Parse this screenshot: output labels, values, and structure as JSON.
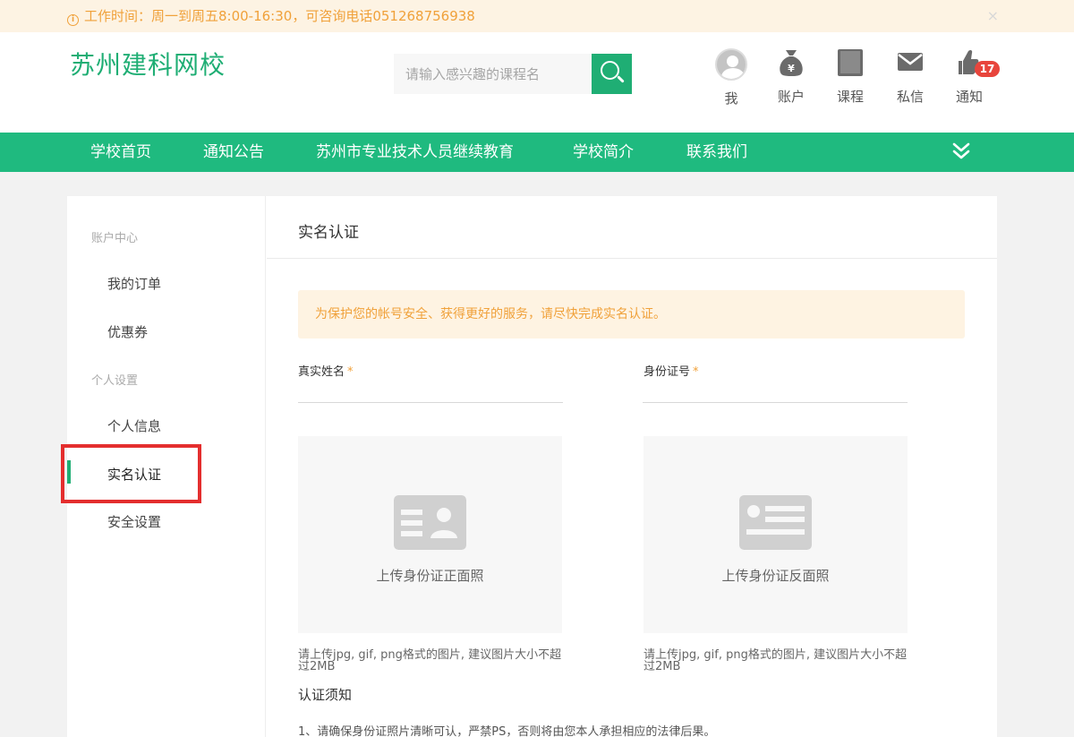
{
  "notice": {
    "text": "工作时间：周一到周五8:00-16:30，可咨询电话051268756938",
    "icon": "info-icon",
    "close": "×"
  },
  "header": {
    "logo": "苏州建科网校",
    "search": {
      "placeholder": "请输入感兴趣的课程名",
      "icon": "search-icon"
    },
    "user_nav": [
      {
        "label": "我",
        "icon": "avatar"
      },
      {
        "label": "账户",
        "icon": "money-bag-icon"
      },
      {
        "label": "课程",
        "icon": "book-icon"
      },
      {
        "label": "私信",
        "icon": "envelope-icon"
      },
      {
        "label": "通知",
        "icon": "bell-icon",
        "badge": "17"
      }
    ]
  },
  "main_nav": [
    "学校首页",
    "通知公告",
    "苏州市专业技术人员继续教育",
    "学校简介",
    "联系我们"
  ],
  "sidebar": {
    "group1": "账户中心",
    "group1_items": [
      "我的订单",
      "优惠券"
    ],
    "group2": "个人设置",
    "group2_items": [
      "个人信息",
      "实名认证",
      "安全设置"
    ],
    "active": "实名认证"
  },
  "main": {
    "title": "实名认证",
    "alert": "为保护您的帐号安全、获得更好的服务，请尽快完成实名认证。",
    "fields": [
      {
        "label": "真实姓名",
        "required": "*"
      },
      {
        "label": "身份证号",
        "required": "*"
      }
    ],
    "uploads": [
      {
        "label": "上传身份证正面照",
        "hint": "请上传jpg, gif, png格式的图片, 建议图片大小不超过2MB"
      },
      {
        "label": "上传身份证反面照",
        "hint": "请上传jpg, gif, png格式的图片, 建议图片大小不超过2MB"
      }
    ],
    "notice_title": "认证须知",
    "notice_lines": [
      "1、请确保身份证照片清晰可认，严禁PS，否则将由您本人承担相应的法律后果。"
    ]
  },
  "colors": {
    "brand_green": "#1fba7f",
    "warning_orange": "#f0a13a",
    "highlight_red": "#e42e2e"
  }
}
